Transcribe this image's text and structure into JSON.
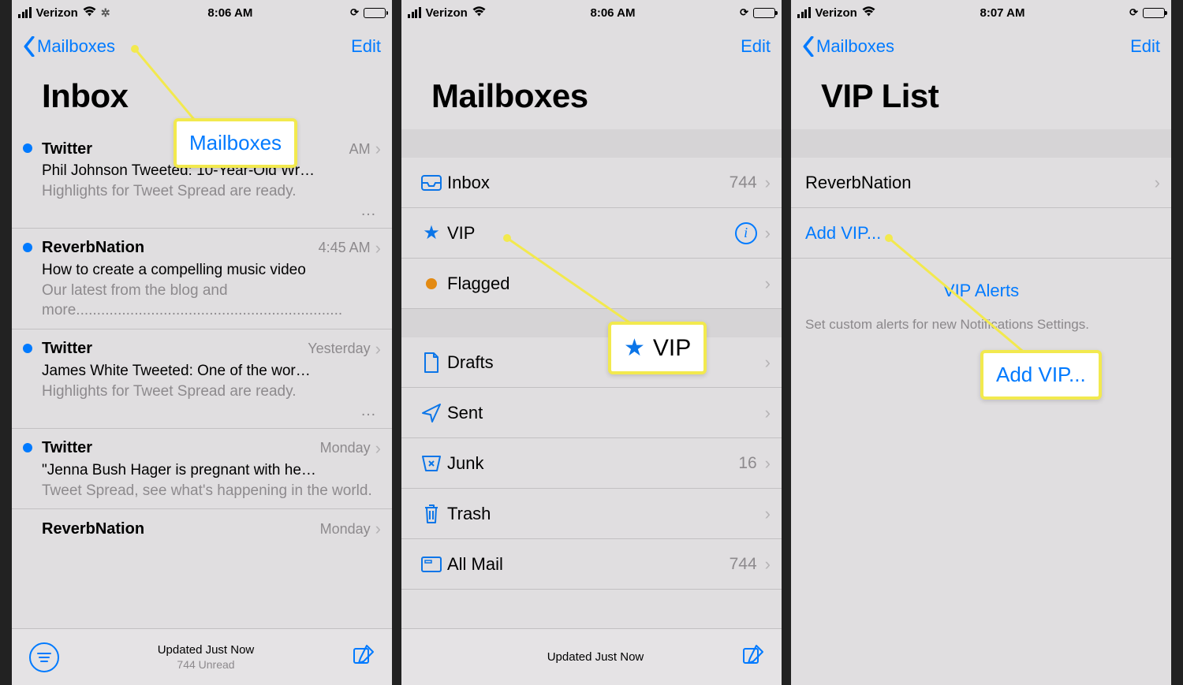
{
  "status": {
    "carrier": "Verizon",
    "time_a": "8:06 AM",
    "time_b": "8:06 AM",
    "time_c": "8:07 AM"
  },
  "nav": {
    "back_mailboxes": "Mailboxes",
    "edit": "Edit"
  },
  "screen1": {
    "title": "Inbox",
    "messages": [
      {
        "sender": "Twitter",
        "time": "AM",
        "subject": "Phil Johnson Tweeted: 10-Year-Old Wr…",
        "preview": "Highlights for Tweet Spread are ready."
      },
      {
        "sender": "ReverbNation",
        "time": "4:45 AM",
        "subject": "How to create a compelling music video",
        "preview": "Our latest from the blog and more................................................................"
      },
      {
        "sender": "Twitter",
        "time": "Yesterday",
        "subject": "James White Tweeted: One of the wor…",
        "preview": "Highlights for Tweet Spread are ready."
      },
      {
        "sender": "Twitter",
        "time": "Monday",
        "subject": "\"Jenna Bush Hager is pregnant with he…",
        "preview": "Tweet Spread, see what's happening in the world."
      },
      {
        "sender": "ReverbNation",
        "time": "Monday",
        "subject": "",
        "preview": ""
      }
    ],
    "toolbar": {
      "status": "Updated Just Now",
      "sub": "744 Unread"
    },
    "callout": "Mailboxes"
  },
  "screen2": {
    "title": "Mailboxes",
    "group1": [
      {
        "icon": "inbox",
        "label": "Inbox",
        "count": "744"
      },
      {
        "icon": "star",
        "label": "VIP",
        "info": true
      },
      {
        "icon": "flag",
        "label": "Flagged"
      }
    ],
    "group2": [
      {
        "icon": "draft",
        "label": "Drafts"
      },
      {
        "icon": "sent",
        "label": "Sent"
      },
      {
        "icon": "junk",
        "label": "Junk",
        "count": "16"
      },
      {
        "icon": "trash",
        "label": "Trash"
      },
      {
        "icon": "allmail",
        "label": "All Mail",
        "count": "744"
      }
    ],
    "toolbar": {
      "status": "Updated Just Now"
    },
    "callout": "VIP"
  },
  "screen3": {
    "title": "VIP List",
    "rows": [
      {
        "label": "ReverbNation",
        "link": false
      },
      {
        "label": "Add VIP...",
        "link": true
      }
    ],
    "alerts_btn": "VIP Alerts",
    "footer": "Set custom alerts for new\nNotifications Settings.",
    "callout": "Add VIP..."
  }
}
